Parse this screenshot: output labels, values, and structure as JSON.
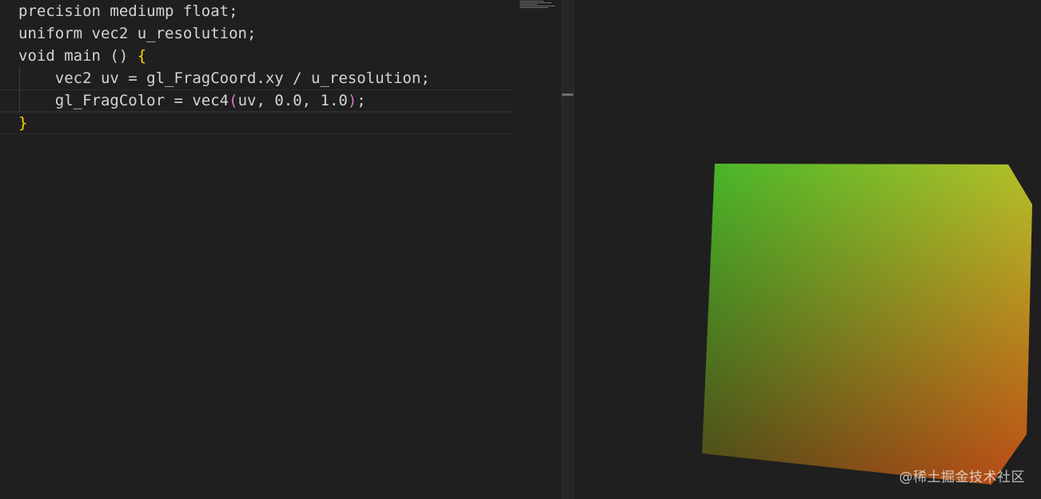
{
  "editor": {
    "lines": [
      "precision mediump float;",
      "uniform vec2 u_resolution;",
      "void main () {",
      "    vec2 uv = gl_FragCoord.xy / u_resolution;",
      "    gl_FragColor = vec4(uv, 0.0, 1.0);",
      "}"
    ],
    "line3": {
      "text": "void main () ",
      "brace": "{"
    },
    "line5": {
      "pre": "    gl_FragColor = vec4",
      "open": "(",
      "args": "uv, 0.0, 1.0",
      "close": ")",
      "post": ";"
    },
    "line6": {
      "brace": "}"
    }
  },
  "preview": {
    "shape_colors": {
      "top_left": "#42b82a",
      "top_right": "#b5c42a",
      "bottom_left": "#4d4418",
      "bottom_right": "#c24a14"
    }
  },
  "watermark": "@稀土掘金技术社区",
  "colors": {
    "background": "#1f1f1f",
    "code_text": "#d4d4d4",
    "bracket_gold": "#ffd700",
    "bracket_purple": "#da70d6"
  }
}
